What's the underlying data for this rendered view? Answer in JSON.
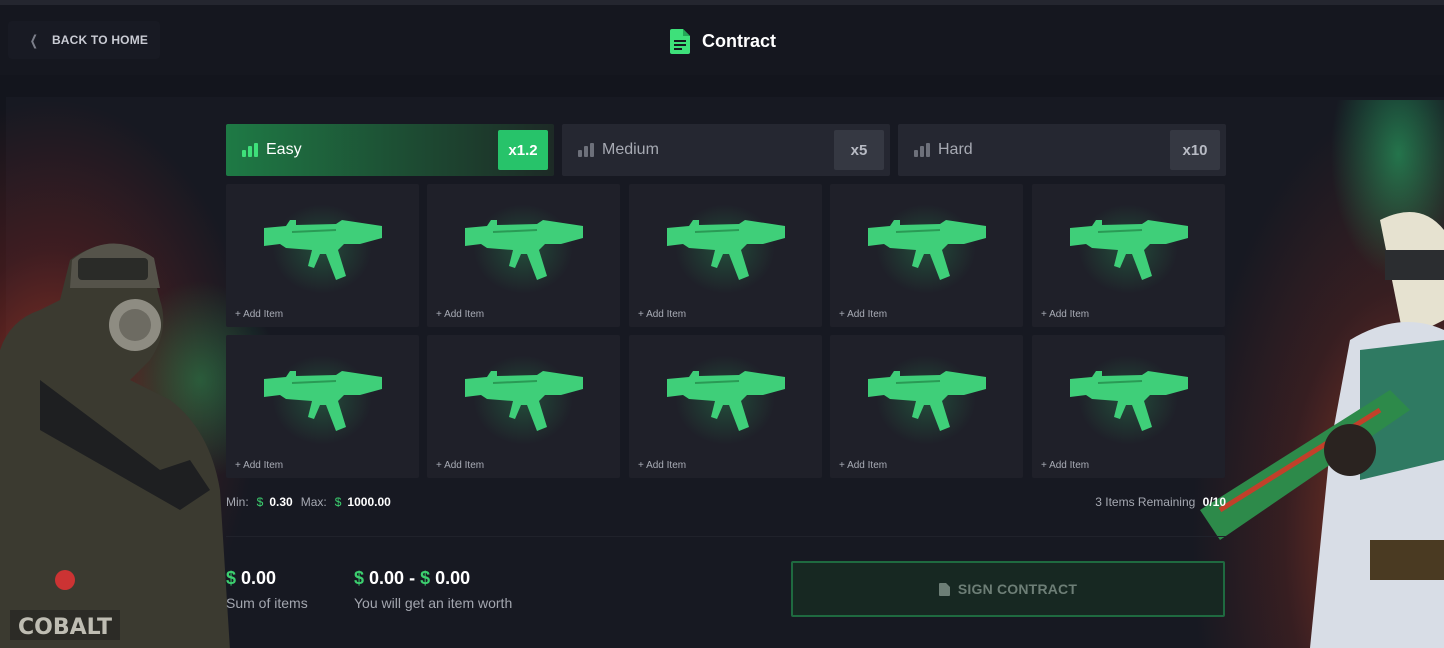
{
  "header": {
    "back_label": "BACK TO HOME",
    "title": "Contract"
  },
  "difficulties": [
    {
      "label": "Easy",
      "multiplier": "x1.2",
      "active": true
    },
    {
      "label": "Medium",
      "multiplier": "x5",
      "active": false
    },
    {
      "label": "Hard",
      "multiplier": "x10",
      "active": false
    }
  ],
  "slots": {
    "add_label": "+ Add Item",
    "count": 10
  },
  "limits": {
    "min_label": "Min:",
    "min_currency": "$",
    "min_value": "0.30",
    "max_label": "Max:",
    "max_currency": "$",
    "max_value": "1000.00"
  },
  "remaining": {
    "label": "3 Items Remaining",
    "count": "0/10"
  },
  "summary": {
    "sum_currency": "$",
    "sum_value": "0.00",
    "sum_label": "Sum of items",
    "range_currency_min": "$",
    "range_min": "0.00",
    "range_sep": "-",
    "range_currency_max": "$",
    "range_max": "0.00",
    "range_label": "You will get an item worth"
  },
  "sign_button": {
    "label": "SIGN CONTRACT"
  },
  "colors": {
    "accent": "#27c36a",
    "background": "#13151d",
    "panel": "#1f2029"
  }
}
